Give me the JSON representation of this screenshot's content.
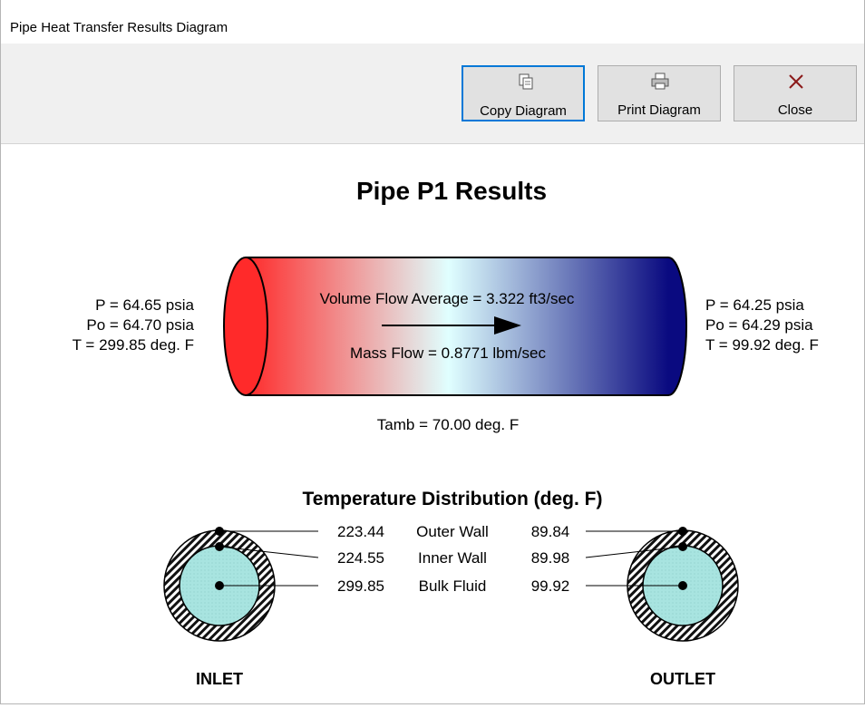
{
  "window": {
    "title": "Pipe Heat Transfer Results Diagram"
  },
  "toolbar": {
    "copy_label": "Copy Diagram",
    "print_label": "Print Diagram",
    "close_label": "Close",
    "copy_icon": "copy-icon",
    "print_icon": "printer-icon",
    "close_icon": "close-icon",
    "close_color": "#8b1a1a",
    "focus_color": "#0078d7"
  },
  "diagram": {
    "title": "Pipe P1 Results",
    "inlet_P": "P = 64.65 psia",
    "inlet_Po": "Po = 64.70 psia",
    "inlet_T": "T = 299.85 deg. F",
    "outlet_P": "P = 64.25 psia",
    "outlet_Po": "Po = 64.29 psia",
    "outlet_T": "T = 99.92 deg. F",
    "volume_flow": "Volume Flow Average = 3.322 ft3/sec",
    "mass_flow": "Mass Flow = 0.8771 lbm/sec",
    "tamb": "Tamb = 70.00 deg. F",
    "gradient_colors": [
      "#ff2a2a",
      "#e0ffff",
      "#0a0a80"
    ],
    "temp_distribution": {
      "title": "Temperature Distribution (deg. F)",
      "rows": [
        {
          "label": "Outer Wall",
          "inlet": "223.44",
          "outlet": "89.84"
        },
        {
          "label": "Inner Wall",
          "inlet": "224.55",
          "outlet": "89.98"
        },
        {
          "label": "Bulk Fluid",
          "inlet": "299.85",
          "outlet": "99.92"
        }
      ],
      "inlet_label": "INLET",
      "outlet_label": "OUTLET",
      "fluid_color": "#a8e4e0"
    }
  }
}
